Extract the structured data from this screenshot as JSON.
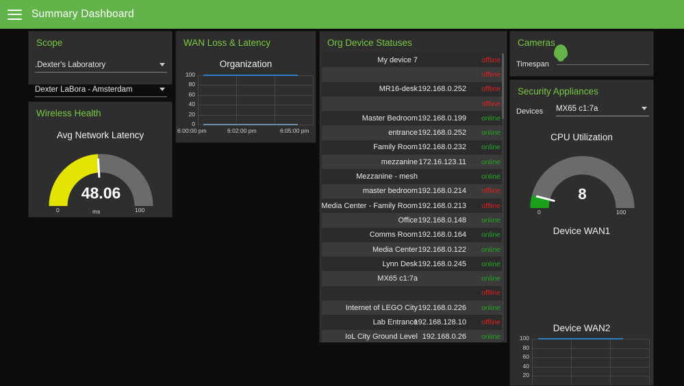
{
  "header": {
    "title": "Summary Dashboard",
    "menu_icon": "hamburger-icon",
    "bg": "#62b44a"
  },
  "scope": {
    "title": "Scope",
    "organization": {
      "value": ".Dexter's Laboratory"
    },
    "network": {
      "value": "Dexter LaBora - Amsterdam"
    }
  },
  "wireless_health": {
    "title": "Wireless Health",
    "gauge": {
      "label": "Avg Network Latency",
      "value": "48.06",
      "unit": "ms",
      "min": "0",
      "max": "100",
      "arc_color": "#e3e300",
      "track_color": "#6b6b6b"
    }
  },
  "wan": {
    "title": "WAN Loss & Latency"
  },
  "devices": {
    "title": "Org Device Statuses",
    "rows": [
      {
        "name": "My device 7",
        "ip": "",
        "status": "offline"
      },
      {
        "name": "",
        "ip": "",
        "status": "offline"
      },
      {
        "name": "MR16-desk",
        "ip": "192.168.0.252",
        "status": "offline"
      },
      {
        "name": "",
        "ip": "",
        "status": "offline"
      },
      {
        "name": "Master Bedroom",
        "ip": "192.168.0.199",
        "status": "online"
      },
      {
        "name": "entrance",
        "ip": "192.168.0.252",
        "status": "online"
      },
      {
        "name": "Family Room",
        "ip": "192.168.0.232",
        "status": "online"
      },
      {
        "name": "mezzanine",
        "ip": "172.16.123.11",
        "status": "online"
      },
      {
        "name": "Mezzanine - mesh",
        "ip": "",
        "status": "online"
      },
      {
        "name": "master bedroom",
        "ip": "192.168.0.214",
        "status": "offline"
      },
      {
        "name": "Media Center - Family Room",
        "ip": "192.168.0.213",
        "status": "offline"
      },
      {
        "name": "Office",
        "ip": "192.168.0.148",
        "status": "online"
      },
      {
        "name": "Comms Room",
        "ip": "192.168.0.164",
        "status": "online"
      },
      {
        "name": "Media Center",
        "ip": "192.168.0.122",
        "status": "online"
      },
      {
        "name": "Lynn Desk",
        "ip": "192.168.0.245",
        "status": "online"
      },
      {
        "name": "MX65 c1:7a",
        "ip": "",
        "status": "online"
      },
      {
        "name": "",
        "ip": "",
        "status": "offline"
      },
      {
        "name": "Internet of LEGO City",
        "ip": "192.168.0.226",
        "status": "online"
      },
      {
        "name": "Lab Entrance",
        "ip": "192.168.128.10",
        "status": "offline"
      },
      {
        "name": "IoL City Ground Level",
        "ip": "192.168.0.26",
        "status": "online"
      }
    ]
  },
  "cameras": {
    "title": "Cameras",
    "timespan_label": "Timespan"
  },
  "security": {
    "title": "Security Appliances",
    "devices_label": "Devices",
    "device_value": "MX65 c1:7a",
    "cpu": {
      "label": "CPU Utilization",
      "value": "8",
      "min": "0",
      "max": "100",
      "arc_color": "#1aa01a",
      "track_color": "#6b6b6b"
    },
    "wan1_label": "Device WAN1",
    "wan2_label": "Device WAN2"
  },
  "chart_data": [
    {
      "id": "wan_organization",
      "type": "line",
      "title": "Organization",
      "xlabel": "",
      "ylabel": "",
      "ylim": [
        0,
        100
      ],
      "yticks": [
        0,
        20,
        40,
        60,
        80,
        100
      ],
      "xticks": [
        "6:00:00 pm",
        "6:02:00 pm",
        "6:05:00 pm"
      ],
      "grid": true,
      "legend": "none",
      "series": [
        {
          "name": "latency",
          "color": "#2f7fc4",
          "x": [
            0.05,
            0.87
          ],
          "values": [
            100,
            100
          ]
        },
        {
          "name": "loss",
          "color": "#6a8fa8",
          "x": [
            0.05,
            0.87
          ],
          "values": [
            0.6,
            0.6
          ]
        }
      ]
    },
    {
      "id": "device_wan2",
      "type": "line",
      "title": "Device WAN2",
      "xlabel": "",
      "ylabel": "",
      "ylim": [
        0,
        100
      ],
      "yticks": [
        20,
        40,
        60,
        80,
        100
      ],
      "xticks": [],
      "grid": true,
      "legend": "none",
      "series": [
        {
          "name": "wan2",
          "color": "#2f7fc4",
          "x": [
            0.05,
            0.78
          ],
          "values": [
            100,
            100
          ]
        }
      ]
    },
    {
      "id": "avg_network_latency_gauge",
      "type": "gauge",
      "title": "Avg Network Latency",
      "value": 48.06,
      "unit": "ms",
      "range": [
        0,
        100
      ],
      "arc_color": "#e3e300"
    },
    {
      "id": "cpu_utilization_gauge",
      "type": "gauge",
      "title": "CPU Utilization",
      "value": 8,
      "unit": "",
      "range": [
        0,
        100
      ],
      "arc_color": "#1aa01a"
    }
  ]
}
